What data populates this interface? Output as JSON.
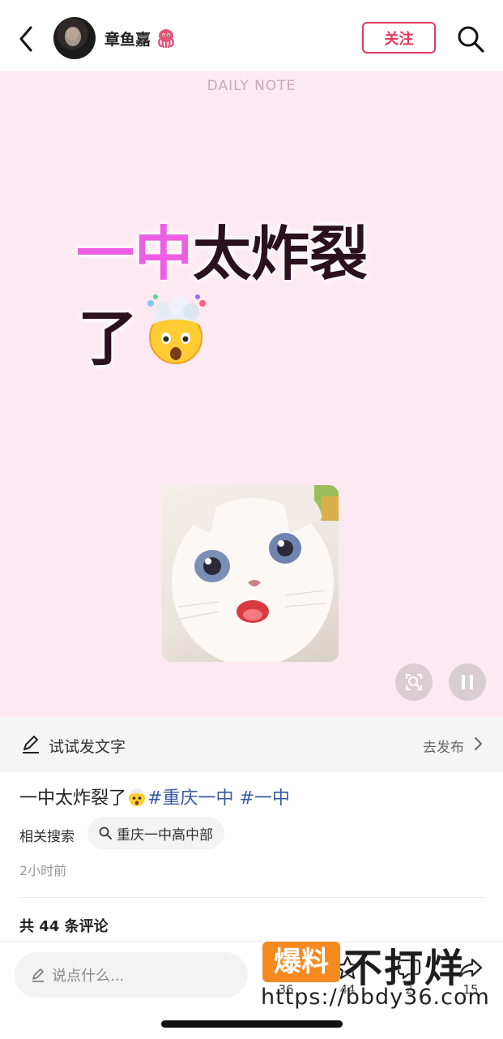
{
  "header": {
    "username": "章鱼嘉",
    "follow_label": "关注",
    "icons": [
      "back-icon",
      "octopus-emoji-icon",
      "search-icon"
    ]
  },
  "media": {
    "daily_note": "DAILY NOTE",
    "headline_pink": "一中",
    "headline_dark": "太炸裂",
    "headline_line2": "了",
    "background_color": "#fde9f1",
    "accent_pink": "#ec5fe2"
  },
  "try_bar": {
    "label": "试试发文字",
    "publish_label": "去发布"
  },
  "post": {
    "caption_text": "一中太炸裂了",
    "tag1": "#重庆一中",
    "tag2": "#一中",
    "related_label": "相关搜索",
    "related_query": "重庆一中高中部",
    "time_ago": "2小时前",
    "comment_count_label": "共 44 条评论"
  },
  "bottom_bar": {
    "input_placeholder": "说点什么...",
    "like_count": "36",
    "collect_count": "44",
    "comment_count": "2",
    "share_count": "15"
  },
  "watermark": {
    "badge": "爆料",
    "text": "不打烊",
    "url": "https://bbdy36.com"
  },
  "colors": {
    "brand_red": "#e23b5c",
    "tag_blue": "#3a5aa8",
    "watermark_orange": "#f58a1f"
  }
}
